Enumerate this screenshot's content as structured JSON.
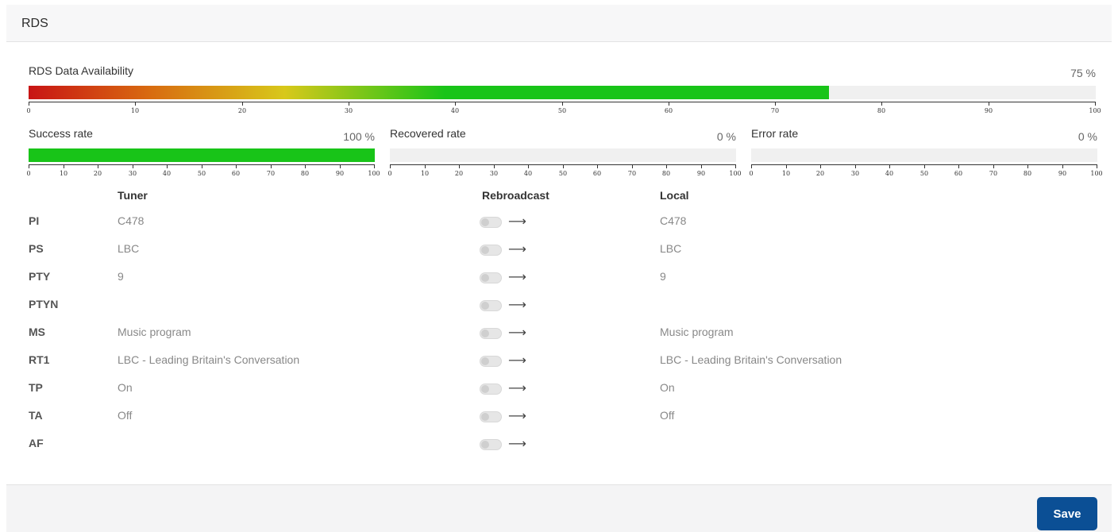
{
  "header": {
    "title": "RDS"
  },
  "availability": {
    "label": "RDS Data Availability",
    "percent_text": "75 %",
    "value": 75,
    "ticks": [
      "0",
      "10",
      "20",
      "30",
      "40",
      "50",
      "60",
      "70",
      "80",
      "90",
      "100"
    ]
  },
  "rates": [
    {
      "label": "Success rate",
      "percent_text": "100 %",
      "value": 100
    },
    {
      "label": "Recovered rate",
      "percent_text": "0 %",
      "value": 0
    },
    {
      "label": "Error rate",
      "percent_text": "0 %",
      "value": 0
    }
  ],
  "small_ticks": [
    "0",
    "10",
    "20",
    "30",
    "40",
    "50",
    "60",
    "70",
    "80",
    "90",
    "100"
  ],
  "columns": {
    "tuner": "Tuner",
    "rebroadcast": "Rebroadcast",
    "local": "Local"
  },
  "rows": [
    {
      "key": "PI",
      "tuner": "C478",
      "local": "C478",
      "arrow": "⟶"
    },
    {
      "key": "PS",
      "tuner": "LBC",
      "local": "LBC",
      "arrow": "⟶"
    },
    {
      "key": "PTY",
      "tuner": "9",
      "local": "9",
      "arrow": "⟶"
    },
    {
      "key": "PTYN",
      "tuner": "",
      "local": "",
      "arrow": "⟶"
    },
    {
      "key": "MS",
      "tuner": "Music program",
      "local": "Music program",
      "arrow": "⟶"
    },
    {
      "key": "RT1",
      "tuner": "LBC - Leading Britain's Conversation",
      "local": "LBC - Leading Britain's Conversation",
      "arrow": "⟶"
    },
    {
      "key": "TP",
      "tuner": "On",
      "local": "On",
      "arrow": "⟶"
    },
    {
      "key": "TA",
      "tuner": "Off",
      "local": "Off",
      "arrow": "⟶"
    },
    {
      "key": "AF",
      "tuner": "",
      "local": "",
      "arrow": "⟶"
    }
  ],
  "footer": {
    "save_label": "Save"
  },
  "colors": {
    "accent": "#0b4f95",
    "success_green": "#18c418",
    "gradient_start": "#c81414",
    "gradient_mid": "#d8c81a"
  }
}
